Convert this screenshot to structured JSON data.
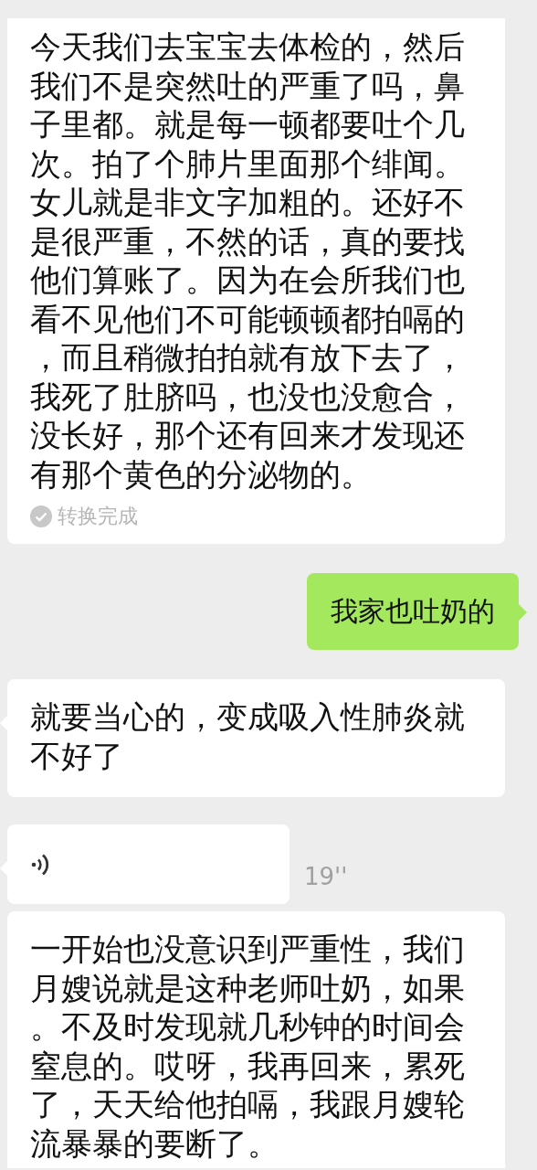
{
  "messages": [
    {
      "kind": "received",
      "tail": false,
      "lines": [
        "今天我们去宝宝去体检的，然后",
        "我们不是突然吐的严重了吗，鼻",
        "子里都。就是每一顿都要吐个几",
        "次。拍了个肺片里面那个绯闻。",
        "女儿就是非文字加粗的。还好不",
        "是很严重，不然的话，真的要找",
        "他们算账了。因为在会所我们也",
        "看不见他们不可能顿顿都拍嗝的",
        "，而且稍微拍拍就有放下去了，",
        "我死了肚脐吗，也没也没愈合，",
        "没长好，那个还有回来才发现还",
        "有那个黄色的分泌物的。"
      ],
      "status": "转换完成"
    },
    {
      "kind": "sent",
      "tail": true,
      "lines": [
        "我家也吐奶的"
      ]
    },
    {
      "kind": "received",
      "tail": true,
      "lines": [
        "就要当心的，变成吸入性肺炎就",
        "不好了"
      ]
    },
    {
      "kind": "voice",
      "tail": true,
      "duration": "19''"
    },
    {
      "kind": "received",
      "tail": false,
      "lines": [
        "一开始也没意识到严重性，我们",
        "月嫂说就是这种老师吐奶，如果",
        "。不及时发现就几秒钟的时间会",
        "窒息的。哎呀，我再回来，累死",
        "了，天天给他拍嗝，我跟月嫂轮",
        "流暴暴的要断了。"
      ]
    }
  ]
}
